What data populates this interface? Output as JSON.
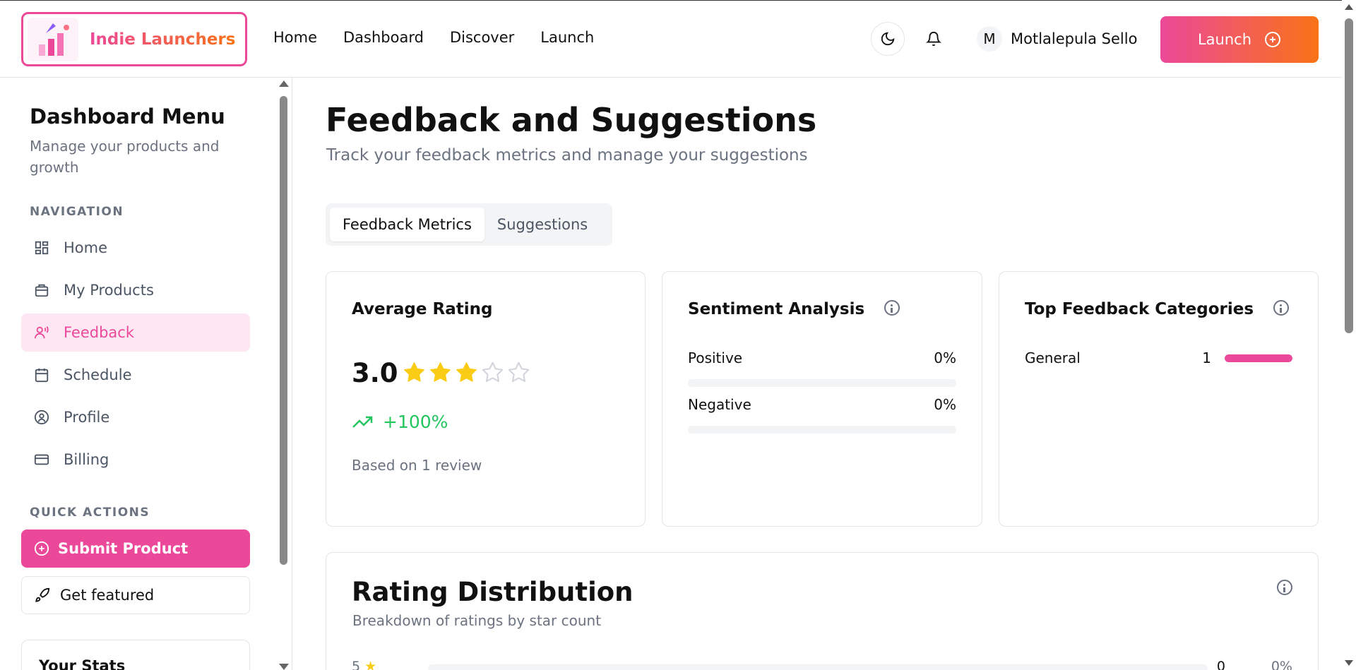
{
  "header": {
    "logo_text": "Indie Launchers",
    "nav": [
      "Home",
      "Dashboard",
      "Discover",
      "Launch"
    ],
    "user_initial": "M",
    "user_name": "Motlalepula Sello",
    "launch_label": "Launch"
  },
  "sidebar": {
    "title": "Dashboard Menu",
    "subtitle": "Manage your products and growth",
    "nav_label": "NAVIGATION",
    "items": [
      {
        "label": "Home",
        "icon": "grid-icon"
      },
      {
        "label": "My Products",
        "icon": "package-icon"
      },
      {
        "label": "Feedback",
        "icon": "feedback-icon",
        "active": true
      },
      {
        "label": "Schedule",
        "icon": "calendar-icon"
      },
      {
        "label": "Profile",
        "icon": "user-circle-icon"
      },
      {
        "label": "Billing",
        "icon": "credit-card-icon"
      }
    ],
    "quick_label": "QUICK ACTIONS",
    "submit_label": "Submit Product",
    "featured_label": "Get featured",
    "stats_title": "Your Stats"
  },
  "main": {
    "title": "Feedback and Suggestions",
    "subtitle": "Track your feedback metrics and manage your suggestions",
    "tabs": [
      "Feedback Metrics",
      "Suggestions"
    ],
    "active_tab": 0
  },
  "average_rating": {
    "title": "Average Rating",
    "value": "3.0",
    "stars_filled": 3,
    "stars_total": 5,
    "trend": "+100%",
    "based_on": "Based on 1 review"
  },
  "sentiment": {
    "title": "Sentiment Analysis",
    "rows": [
      {
        "label": "Positive",
        "pct": "0%",
        "fraction": 0
      },
      {
        "label": "Negative",
        "pct": "0%",
        "fraction": 0
      }
    ]
  },
  "categories": {
    "title": "Top Feedback Categories",
    "rows": [
      {
        "label": "General",
        "count": "1",
        "fraction": 1
      }
    ]
  },
  "distribution": {
    "title": "Rating Distribution",
    "subtitle": "Breakdown of ratings by star count",
    "rows": [
      {
        "star": "5",
        "count": "0",
        "pct": "0%"
      }
    ]
  },
  "colors": {
    "accent": "#ec4899",
    "accent_end": "#f97316",
    "star": "#facc15",
    "trend": "#22c55e"
  }
}
